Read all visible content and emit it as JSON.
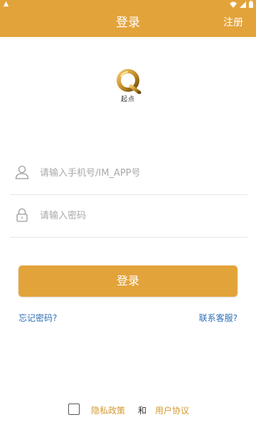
{
  "colors": {
    "accent": "#e3a33b",
    "link": "#2f6fb6",
    "policy": "#d49a30"
  },
  "status_bar": {
    "icons": [
      "android-icon",
      "wifi-icon",
      "signal-icon",
      "battery-icon"
    ]
  },
  "header": {
    "title": "登录",
    "right_action": "注册"
  },
  "logo": {
    "text": "起点"
  },
  "form": {
    "phone": {
      "placeholder": "请输入手机号/IM_APP号",
      "value": "",
      "icon": "user-icon"
    },
    "password": {
      "placeholder": "请输入密码",
      "value": "",
      "icon": "lock-icon"
    }
  },
  "actions": {
    "login_label": "登录",
    "forgot_label": "忘记密码?",
    "support_label": "联系客服?"
  },
  "footer": {
    "privacy_label": "隐私政策",
    "and_label": "和",
    "agreement_label": "用户协议"
  }
}
